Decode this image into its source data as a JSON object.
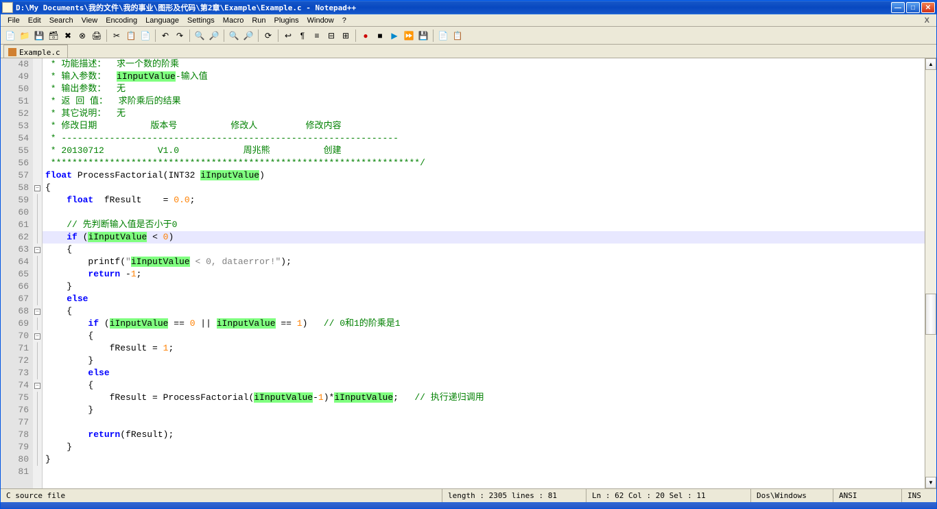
{
  "title": "D:\\My Documents\\我的文件\\我的事业\\图形及代码\\第2章\\Example\\Example.c - Notepad++",
  "menu": [
    "File",
    "Edit",
    "Search",
    "View",
    "Encoding",
    "Language",
    "Settings",
    "Macro",
    "Run",
    "Plugins",
    "Window",
    "?"
  ],
  "menu_close": "X",
  "tab": {
    "label": "Example.c"
  },
  "line_start": 48,
  "line_end": 81,
  "code": {
    "l48": " * 功能描述：  求一个数的阶乘",
    "l49a": " * 输入参数：  ",
    "l49b": "iInputValue",
    "l49c": "-输入值",
    "l50": " * 输出参数：  无",
    "l51": " * 返 回 值：  求阶乘后的结果",
    "l52": " * 其它说明：  无",
    "l53": " * 修改日期          版本号          修改人         修改内容",
    "l54": " * ---------------------------------------------------------------",
    "l55": " * 20130712          V1.0            周兆熊          创建",
    "l56": " *********************************************************************/",
    "l57a": "float",
    "l57b": " ProcessFactorial(INT32 ",
    "l57c": "iInputValue",
    "l57d": ")",
    "l58": "{",
    "l59a": "    ",
    "l59b": "float",
    "l59c": "  fResult    = ",
    "l59d": "0.0",
    "l59e": ";",
    "l61": "    // 先判断输入值是否小于0",
    "l62a": "    ",
    "l62b": "if",
    "l62c": " (",
    "l62d": "iInputValue",
    "l62e": " < ",
    "l62f": "0",
    "l62g": ")",
    "l63": "    {",
    "l64a": "        printf(",
    "l64b": "\"",
    "l64c": "iInputValue",
    "l64d": " < 0, dataerror!\"",
    "l64e": ");",
    "l65a": "        ",
    "l65b": "return",
    "l65c": " -",
    "l65d": "1",
    "l65e": ";",
    "l66": "    }",
    "l67a": "    ",
    "l67b": "else",
    "l68": "    {",
    "l69a": "        ",
    "l69b": "if",
    "l69c": " (",
    "l69d": "iInputValue",
    "l69e": " == ",
    "l69f": "0",
    "l69g": " || ",
    "l69h": "iInputValue",
    "l69i": " == ",
    "l69j": "1",
    "l69k": ")   ",
    "l69l": "// 0和1的阶乘是1",
    "l70": "        {",
    "l71a": "            fResult = ",
    "l71b": "1",
    "l71c": ";",
    "l72": "        }",
    "l73a": "        ",
    "l73b": "else",
    "l74": "        {",
    "l75a": "            fResult = ProcessFactorial(",
    "l75b": "iInputValue",
    "l75c": "-",
    "l75d": "1",
    "l75e": ")*",
    "l75f": "iInputValue",
    "l75g": ";   ",
    "l75h": "// 执行递归调用",
    "l76": "        }",
    "l78a": "        ",
    "l78b": "return",
    "l78c": "(fResult);",
    "l79": "    }",
    "l80": "}"
  },
  "status": {
    "filetype": "C source file",
    "length": "length : 2305    lines : 81",
    "pos": "Ln : 62    Col : 20    Sel : 11",
    "eol": "Dos\\Windows",
    "enc": "ANSI",
    "mode": "INS"
  },
  "icons": {
    "new": "📄",
    "open": "📁",
    "save": "💾",
    "saveall": "🗃",
    "close": "✖",
    "closeall": "⊗",
    "print": "🖨",
    "cut": "✂",
    "copy": "📋",
    "paste": "📄",
    "undo": "↶",
    "redo": "↷",
    "find": "🔍",
    "replace": "🔎",
    "zoomin": "🔍",
    "zoomout": "🔎",
    "sync": "⟳",
    "wrap": "↩",
    "chars": "¶",
    "indent": "≡",
    "fold": "⊟",
    "unfold": "⊞",
    "rec": "●",
    "stop": "■",
    "play": "▶",
    "playm": "⏩",
    "savem": "💾",
    "doc1": "📄",
    "doc2": "📋"
  }
}
